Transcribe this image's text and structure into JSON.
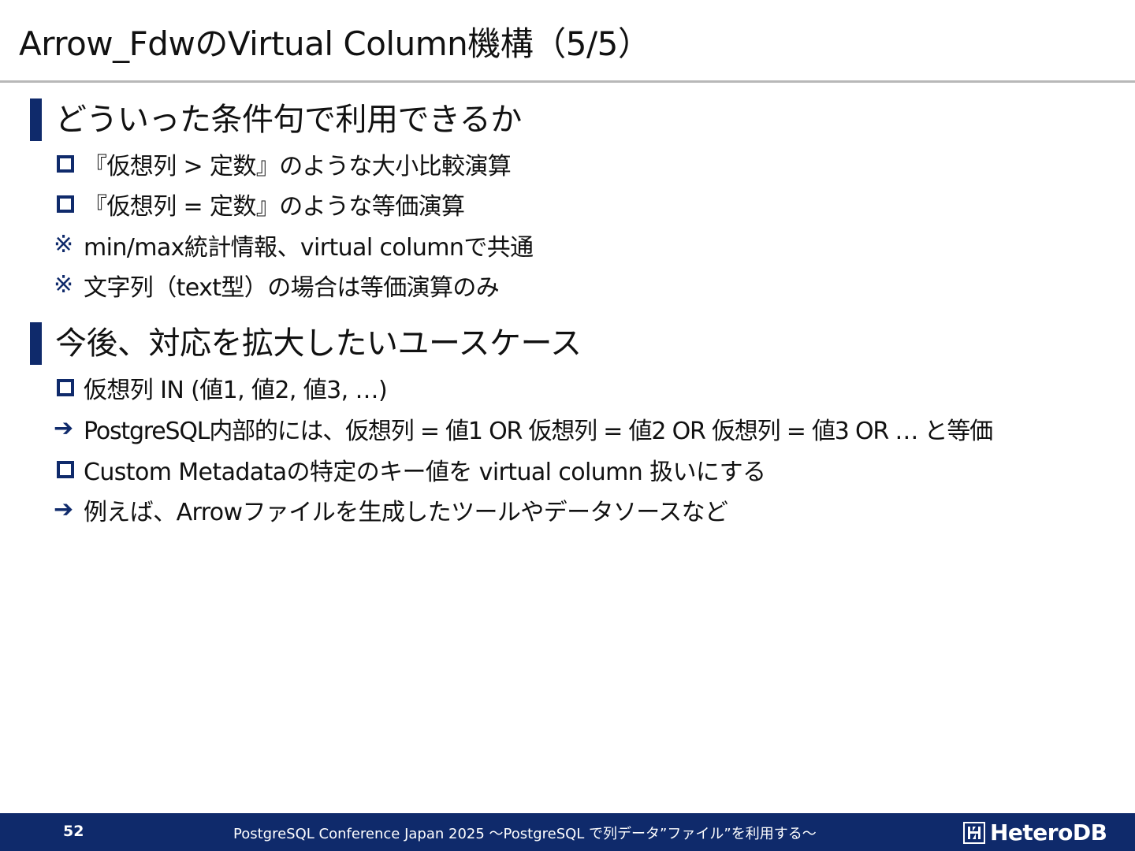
{
  "slide": {
    "title": "Arrow_FdwのVirtual Column機構（5/5）"
  },
  "sections": [
    {
      "heading": "どういった条件句で利用できるか",
      "items": [
        {
          "marker": "square",
          "text": "『仮想列 > 定数』のような大小比較演算"
        },
        {
          "marker": "square",
          "text": "『仮想列 = 定数』のような等価演算"
        },
        {
          "marker": "note",
          "symbol": "※",
          "text": "min/max統計情報、virtual columnで共通"
        },
        {
          "marker": "note",
          "symbol": "※",
          "text": "文字列（text型）の場合は等価演算のみ"
        }
      ]
    },
    {
      "heading": "今後、対応を拡大したいユースケース",
      "items": [
        {
          "marker": "square",
          "text": "仮想列 IN (値1, 値2, 値3, …)"
        },
        {
          "marker": "arrow",
          "text": "PostgreSQL内部的には、仮想列 = 値1 OR 仮想列 = 値2 OR 仮想列 = 値3 OR … と等価"
        },
        {
          "marker": "square",
          "text": "Custom Metadataの特定のキー値を virtual column 扱いにする"
        },
        {
          "marker": "arrow",
          "text": "例えば、Arrowファイルを生成したツールやデータソースなど"
        }
      ]
    }
  ],
  "footer": {
    "page_number": "52",
    "conference": "PostgreSQL Conference Japan 2025 ～PostgreSQL で列データ”ファイル”を利用する～",
    "logo_text": "HeteroDB",
    "logo_icon": "heterodb-logo-icon"
  },
  "colors": {
    "accent": "#0f2a6b",
    "rule": "#b8b8b8",
    "text": "#111111"
  }
}
